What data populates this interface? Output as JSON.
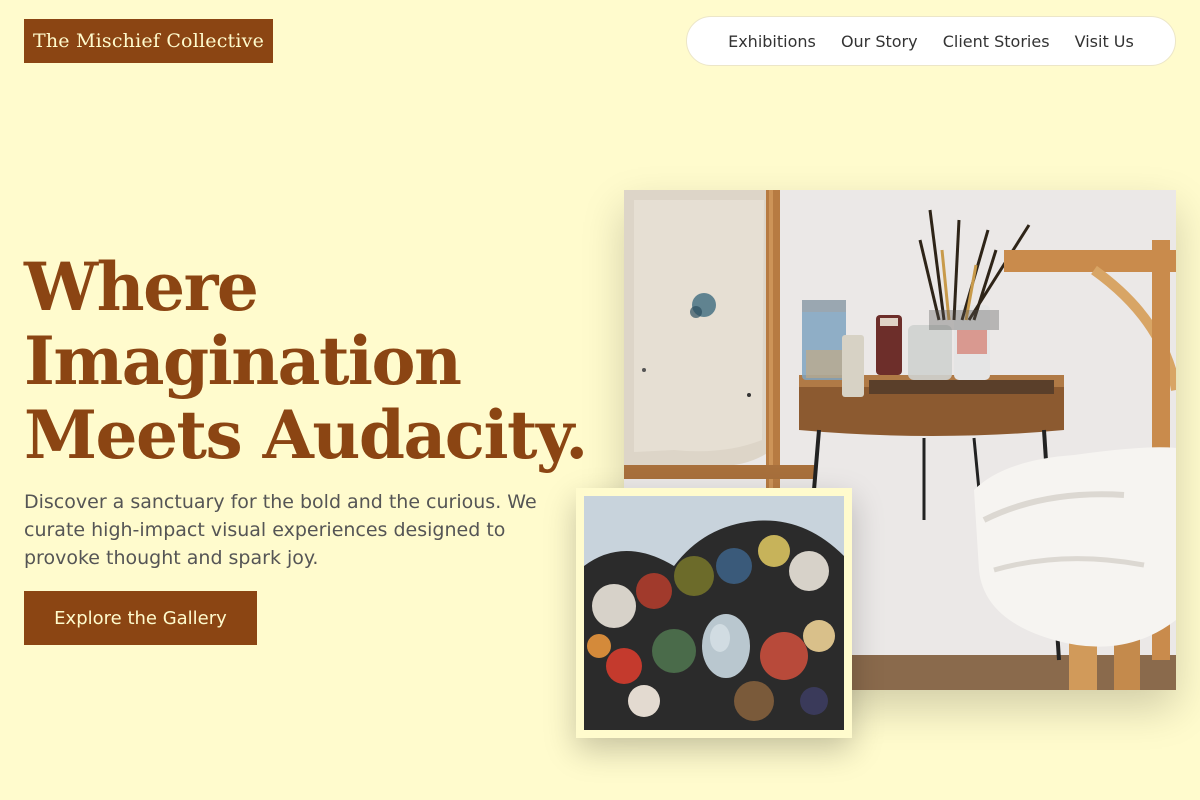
{
  "brand": {
    "name": "The Mischief Collective"
  },
  "nav": {
    "items": [
      {
        "label": "Exhibitions"
      },
      {
        "label": "Our Story"
      },
      {
        "label": "Client Stories"
      },
      {
        "label": "Visit Us"
      }
    ]
  },
  "hero": {
    "headline_lines": [
      "Where",
      "Imagination",
      "Meets Audacity."
    ],
    "subtext": "Discover a sanctuary for the bold and the curious. We curate high-impact visual experiences designed to provoke thought and spark joy.",
    "cta_label": "Explore the Gallery"
  },
  "colors": {
    "background": "#fffbcd",
    "brand": "#8b4513",
    "nav_bg": "#ffffff"
  }
}
